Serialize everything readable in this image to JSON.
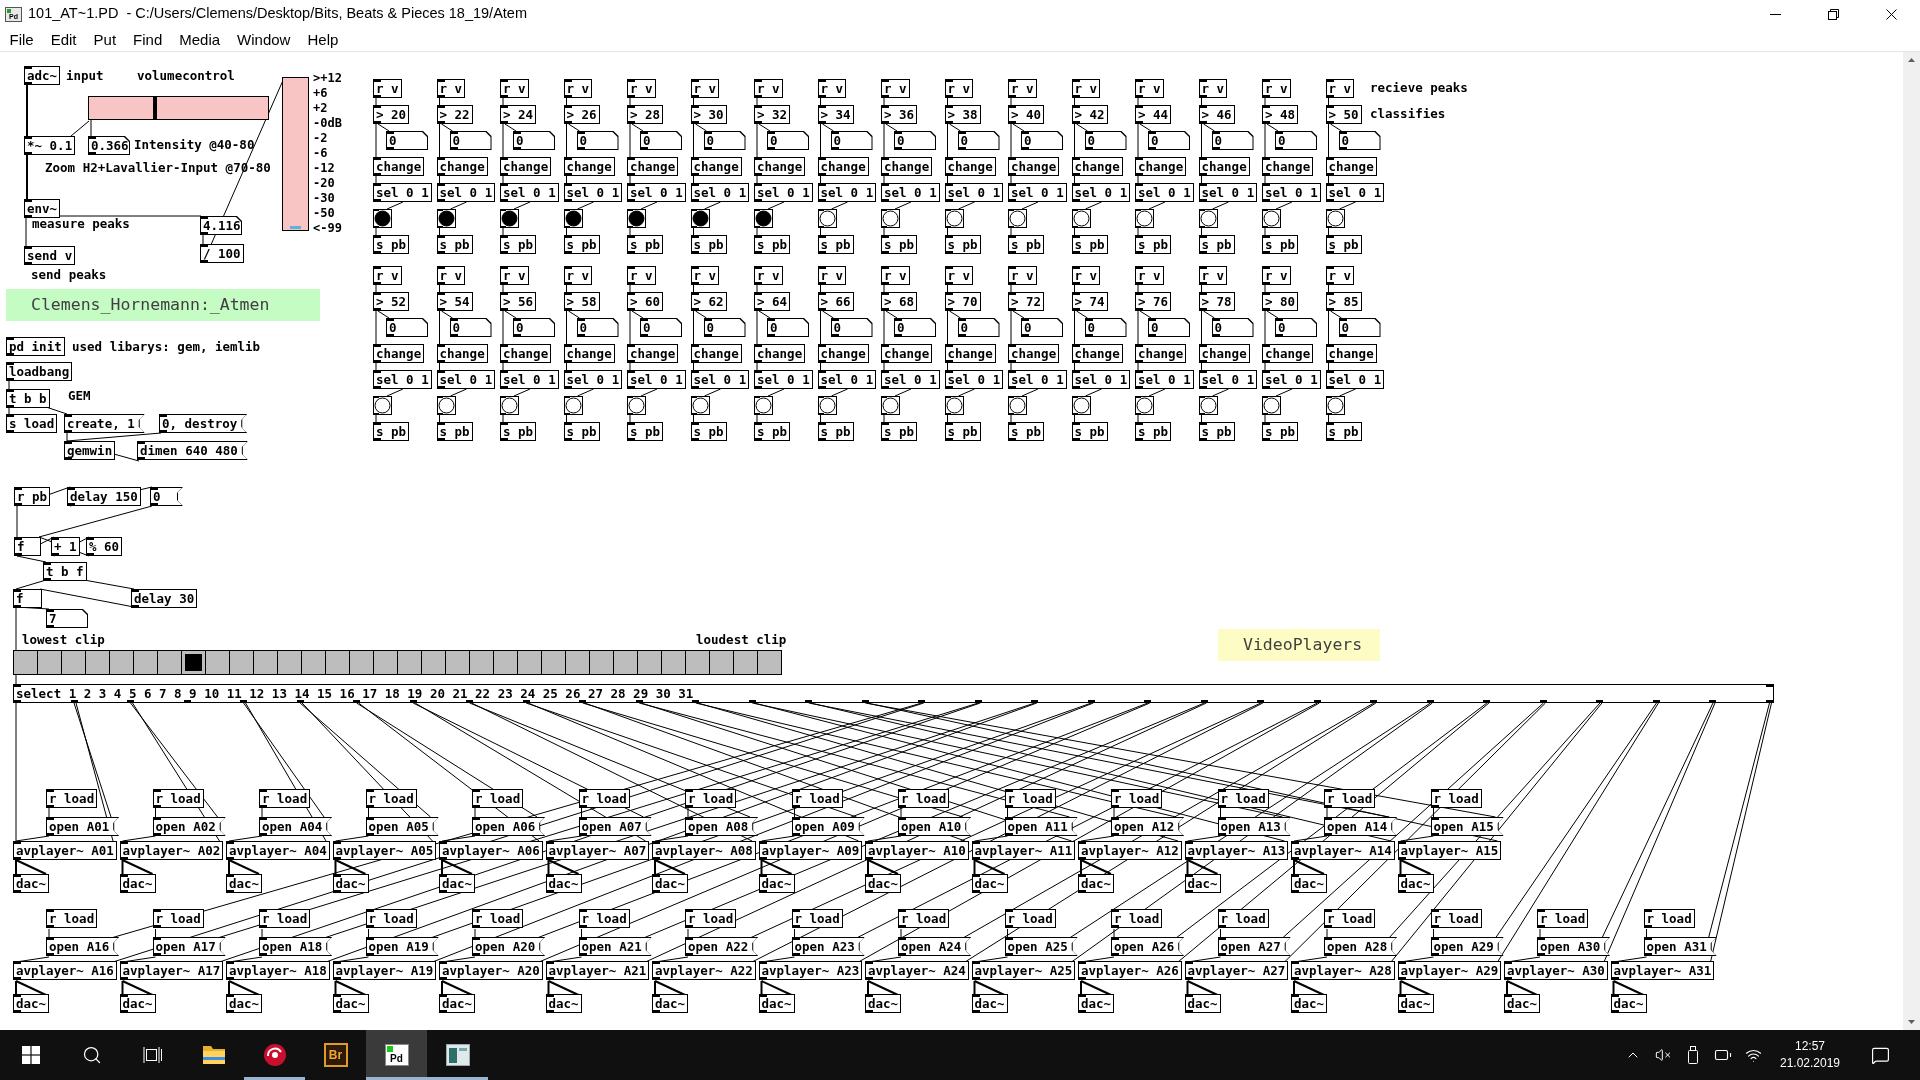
{
  "window": {
    "icon_text": "Pd",
    "title": "101_AT~1.PD  - C:/Users/Clemens/Desktop/Bits, Beats & Pieces 18_19/Atem"
  },
  "menu": [
    "File",
    "Edit",
    "Put",
    "Find",
    "Media",
    "Window",
    "Help"
  ],
  "patch": {
    "objects": [
      {
        "kind": "object",
        "text": "adc~"
      },
      {
        "kind": "comment",
        "text": "input"
      },
      {
        "kind": "comment",
        "text": "volumecontrol"
      },
      {
        "kind": "object",
        "text": "*~ 0.1"
      },
      {
        "kind": "number",
        "text": "0.366"
      },
      {
        "kind": "comment",
        "text": "Intensity @40-80"
      },
      {
        "kind": "comment",
        "text": "Zoom H2+Lavallier-Input @70-80"
      },
      {
        "kind": "object",
        "text": "env~"
      },
      {
        "kind": "comment",
        "text": "measure peaks"
      },
      {
        "kind": "number",
        "text": "4.116"
      },
      {
        "kind": "object",
        "text": "/ 100"
      },
      {
        "kind": "object",
        "text": "send v"
      },
      {
        "kind": "comment",
        "text": "send peaks"
      },
      {
        "kind": "canvas_label",
        "text": "Clemens_Hornemann:_Atmen",
        "color": "#c4fcc4"
      },
      {
        "kind": "object",
        "text": "pd init"
      },
      {
        "kind": "comment",
        "text": "used libarys: gem, iemlib"
      },
      {
        "kind": "object",
        "text": "loadbang"
      },
      {
        "kind": "object",
        "text": "t b b"
      },
      {
        "kind": "comment",
        "text": "GEM"
      },
      {
        "kind": "object",
        "text": "s load"
      },
      {
        "kind": "message",
        "text": "create, 1"
      },
      {
        "kind": "message",
        "text": "0, destroy"
      },
      {
        "kind": "object",
        "text": "gemwin"
      },
      {
        "kind": "message",
        "text": "dimen 640 480"
      },
      {
        "kind": "object",
        "text": "r pb"
      },
      {
        "kind": "object",
        "text": "delay 150"
      },
      {
        "kind": "message",
        "text": "0"
      },
      {
        "kind": "object",
        "text": "f"
      },
      {
        "kind": "object",
        "text": "+ 1"
      },
      {
        "kind": "object",
        "text": "% 60"
      },
      {
        "kind": "object",
        "text": "t b f"
      },
      {
        "kind": "object",
        "text": "f"
      },
      {
        "kind": "object",
        "text": "delay 30"
      },
      {
        "kind": "number",
        "text": "7"
      },
      {
        "kind": "comment",
        "text": "lowest clip"
      },
      {
        "kind": "comment",
        "text": "loudest clip"
      },
      {
        "kind": "canvas_label",
        "text": "VideoPlayers",
        "color": "#fcfcc4"
      }
    ],
    "volume_slider": {
      "level": 0.366
    },
    "vu_meter": {
      "level": 0.02,
      "scale": [
        ">+12",
        "+6",
        "+2",
        "-0dB",
        "-2",
        "-6",
        "-12",
        "-20",
        "-30",
        "-50",
        "<-99"
      ]
    },
    "peak_comments": [
      "recieve peaks",
      "classifies"
    ],
    "peak_blocks": [
      {
        "columns": [
          {
            "receive": "r v",
            "compare": "> 20",
            "number": "0",
            "change": "change",
            "select": "sel 0 1",
            "bang": {
              "on": true
            },
            "send": "s pb"
          },
          {
            "receive": "r v",
            "compare": "> 22",
            "number": "0",
            "change": "change",
            "select": "sel 0 1",
            "bang": {
              "on": true
            },
            "send": "s pb"
          },
          {
            "receive": "r v",
            "compare": "> 24",
            "number": "0",
            "change": "change",
            "select": "sel 0 1",
            "bang": {
              "on": true
            },
            "send": "s pb"
          },
          {
            "receive": "r v",
            "compare": "> 26",
            "number": "0",
            "change": "change",
            "select": "sel 0 1",
            "bang": {
              "on": true
            },
            "send": "s pb"
          },
          {
            "receive": "r v",
            "compare": "> 28",
            "number": "0",
            "change": "change",
            "select": "sel 0 1",
            "bang": {
              "on": true
            },
            "send": "s pb"
          },
          {
            "receive": "r v",
            "compare": "> 30",
            "number": "0",
            "change": "change",
            "select": "sel 0 1",
            "bang": {
              "on": true
            },
            "send": "s pb"
          },
          {
            "receive": "r v",
            "compare": "> 32",
            "number": "0",
            "change": "change",
            "select": "sel 0 1",
            "bang": {
              "on": true
            },
            "send": "s pb"
          },
          {
            "receive": "r v",
            "compare": "> 34",
            "number": "0",
            "change": "change",
            "select": "sel 0 1",
            "bang": {
              "on": false
            },
            "send": "s pb"
          },
          {
            "receive": "r v",
            "compare": "> 36",
            "number": "0",
            "change": "change",
            "select": "sel 0 1",
            "bang": {
              "on": false
            },
            "send": "s pb"
          },
          {
            "receive": "r v",
            "compare": "> 38",
            "number": "0",
            "change": "change",
            "select": "sel 0 1",
            "bang": {
              "on": false
            },
            "send": "s pb"
          },
          {
            "receive": "r v",
            "compare": "> 40",
            "number": "0",
            "change": "change",
            "select": "sel 0 1",
            "bang": {
              "on": false
            },
            "send": "s pb"
          },
          {
            "receive": "r v",
            "compare": "> 42",
            "number": "0",
            "change": "change",
            "select": "sel 0 1",
            "bang": {
              "on": false
            },
            "send": "s pb"
          },
          {
            "receive": "r v",
            "compare": "> 44",
            "number": "0",
            "change": "change",
            "select": "sel 0 1",
            "bang": {
              "on": false
            },
            "send": "s pb"
          },
          {
            "receive": "r v",
            "compare": "> 46",
            "number": "0",
            "change": "change",
            "select": "sel 0 1",
            "bang": {
              "on": false
            },
            "send": "s pb"
          },
          {
            "receive": "r v",
            "compare": "> 48",
            "number": "0",
            "change": "change",
            "select": "sel 0 1",
            "bang": {
              "on": false
            },
            "send": "s pb"
          },
          {
            "receive": "r v",
            "compare": "> 50",
            "number": "0",
            "change": "change",
            "select": "sel 0 1",
            "bang": {
              "on": false
            },
            "send": "s pb"
          }
        ]
      },
      {
        "columns": [
          {
            "receive": "r v",
            "compare": "> 52",
            "number": "0",
            "change": "change",
            "select": "sel 0 1",
            "bang": {
              "on": false
            },
            "send": "s pb"
          },
          {
            "receive": "r v",
            "compare": "> 54",
            "number": "0",
            "change": "change",
            "select": "sel 0 1",
            "bang": {
              "on": false
            },
            "send": "s pb"
          },
          {
            "receive": "r v",
            "compare": "> 56",
            "number": "0",
            "change": "change",
            "select": "sel 0 1",
            "bang": {
              "on": false
            },
            "send": "s pb"
          },
          {
            "receive": "r v",
            "compare": "> 58",
            "number": "0",
            "change": "change",
            "select": "sel 0 1",
            "bang": {
              "on": false
            },
            "send": "s pb"
          },
          {
            "receive": "r v",
            "compare": "> 60",
            "number": "0",
            "change": "change",
            "select": "sel 0 1",
            "bang": {
              "on": false
            },
            "send": "s pb"
          },
          {
            "receive": "r v",
            "compare": "> 62",
            "number": "0",
            "change": "change",
            "select": "sel 0 1",
            "bang": {
              "on": false
            },
            "send": "s pb"
          },
          {
            "receive": "r v",
            "compare": "> 64",
            "number": "0",
            "change": "change",
            "select": "sel 0 1",
            "bang": {
              "on": false
            },
            "send": "s pb"
          },
          {
            "receive": "r v",
            "compare": "> 66",
            "number": "0",
            "change": "change",
            "select": "sel 0 1",
            "bang": {
              "on": false
            },
            "send": "s pb"
          },
          {
            "receive": "r v",
            "compare": "> 68",
            "number": "0",
            "change": "change",
            "select": "sel 0 1",
            "bang": {
              "on": false
            },
            "send": "s pb"
          },
          {
            "receive": "r v",
            "compare": "> 70",
            "number": "0",
            "change": "change",
            "select": "sel 0 1",
            "bang": {
              "on": false
            },
            "send": "s pb"
          },
          {
            "receive": "r v",
            "compare": "> 72",
            "number": "0",
            "change": "change",
            "select": "sel 0 1",
            "bang": {
              "on": false
            },
            "send": "s pb"
          },
          {
            "receive": "r v",
            "compare": "> 74",
            "number": "0",
            "change": "change",
            "select": "sel 0 1",
            "bang": {
              "on": false
            },
            "send": "s pb"
          },
          {
            "receive": "r v",
            "compare": "> 76",
            "number": "0",
            "change": "change",
            "select": "sel 0 1",
            "bang": {
              "on": false
            },
            "send": "s pb"
          },
          {
            "receive": "r v",
            "compare": "> 78",
            "number": "0",
            "change": "change",
            "select": "sel 0 1",
            "bang": {
              "on": false
            },
            "send": "s pb"
          },
          {
            "receive": "r v",
            "compare": "> 80",
            "number": "0",
            "change": "change",
            "select": "sel 0 1",
            "bang": {
              "on": false
            },
            "send": "s pb"
          },
          {
            "receive": "r v",
            "compare": "> 85",
            "number": "0",
            "change": "change",
            "select": "sel 0 1",
            "bang": {
              "on": false
            },
            "send": "s pb"
          }
        ]
      }
    ],
    "clip_selector": {
      "cells": [
        {
          "selected": false
        },
        {
          "selected": false
        },
        {
          "selected": false
        },
        {
          "selected": false
        },
        {
          "selected": false
        },
        {
          "selected": false
        },
        {
          "selected": false
        },
        {
          "selected": true
        },
        {
          "selected": false
        },
        {
          "selected": false
        },
        {
          "selected": false
        },
        {
          "selected": false
        },
        {
          "selected": false
        },
        {
          "selected": false
        },
        {
          "selected": false
        },
        {
          "selected": false
        },
        {
          "selected": false
        },
        {
          "selected": false
        },
        {
          "selected": false
        },
        {
          "selected": false
        },
        {
          "selected": false
        },
        {
          "selected": false
        },
        {
          "selected": false
        },
        {
          "selected": false
        },
        {
          "selected": false
        },
        {
          "selected": false
        },
        {
          "selected": false
        },
        {
          "selected": false
        },
        {
          "selected": false
        },
        {
          "selected": false
        },
        {
          "selected": false
        },
        {
          "selected": false
        }
      ]
    },
    "select_object": "select 1 2 3 4 5 6 7 8 9 10 11 12 13 14 15 16 17 18 19 20 21 22 23 24 25 26 27 28 29 30 31",
    "player_rows": [
      {
        "players": [
          {
            "receive": "r load",
            "message": "open A01",
            "player": "avplayer~ A01",
            "output": "dac~"
          },
          {
            "receive": "r load",
            "message": "open A02",
            "player": "avplayer~ A02",
            "output": "dac~"
          },
          {
            "receive": "r load",
            "message": "open A04",
            "player": "avplayer~ A04",
            "output": "dac~"
          },
          {
            "receive": "r load",
            "message": "open A05",
            "player": "avplayer~ A05",
            "output": "dac~"
          },
          {
            "receive": "r load",
            "message": "open A06",
            "player": "avplayer~ A06",
            "output": "dac~"
          },
          {
            "receive": "r load",
            "message": "open A07",
            "player": "avplayer~ A07",
            "output": "dac~"
          },
          {
            "receive": "r load",
            "message": "open A08",
            "player": "avplayer~ A08",
            "output": "dac~"
          },
          {
            "receive": "r load",
            "message": "open A09",
            "player": "avplayer~ A09",
            "output": "dac~"
          },
          {
            "receive": "r load",
            "message": "open A10",
            "player": "avplayer~ A10",
            "output": "dac~"
          },
          {
            "receive": "r load",
            "message": "open A11",
            "player": "avplayer~ A11",
            "output": "dac~"
          },
          {
            "receive": "r load",
            "message": "open A12",
            "player": "avplayer~ A12",
            "output": "dac~"
          },
          {
            "receive": "r load",
            "message": "open A13",
            "player": "avplayer~ A13",
            "output": "dac~"
          },
          {
            "receive": "r load",
            "message": "open A14",
            "player": "avplayer~ A14",
            "output": "dac~"
          },
          {
            "receive": "r load",
            "message": "open A15",
            "player": "avplayer~ A15",
            "output": "dac~"
          }
        ]
      },
      {
        "players": [
          {
            "receive": "r load",
            "message": "open A16",
            "player": "avplayer~ A16",
            "output": "dac~"
          },
          {
            "receive": "r load",
            "message": "open A17",
            "player": "avplayer~ A17",
            "output": "dac~"
          },
          {
            "receive": "r load",
            "message": "open A18",
            "player": "avplayer~ A18",
            "output": "dac~"
          },
          {
            "receive": "r load",
            "message": "open A19",
            "player": "avplayer~ A19",
            "output": "dac~"
          },
          {
            "receive": "r load",
            "message": "open A20",
            "player": "avplayer~ A20",
            "output": "dac~"
          },
          {
            "receive": "r load",
            "message": "open A21",
            "player": "avplayer~ A21",
            "output": "dac~"
          },
          {
            "receive": "r load",
            "message": "open A22",
            "player": "avplayer~ A22",
            "output": "dac~"
          },
          {
            "receive": "r load",
            "message": "open A23",
            "player": "avplayer~ A23",
            "output": "dac~"
          },
          {
            "receive": "r load",
            "message": "open A24",
            "player": "avplayer~ A24",
            "output": "dac~"
          },
          {
            "receive": "r load",
            "message": "open A25",
            "player": "avplayer~ A25",
            "output": "dac~"
          },
          {
            "receive": "r load",
            "message": "open A26",
            "player": "avplayer~ A26",
            "output": "dac~"
          },
          {
            "receive": "r load",
            "message": "open A27",
            "player": "avplayer~ A27",
            "output": "dac~"
          },
          {
            "receive": "r load",
            "message": "open A28",
            "player": "avplayer~ A28",
            "output": "dac~"
          },
          {
            "receive": "r load",
            "message": "open A29",
            "player": "avplayer~ A29",
            "output": "dac~"
          },
          {
            "receive": "r load",
            "message": "open A30",
            "player": "avplayer~ A30",
            "output": "dac~"
          },
          {
            "receive": "r load",
            "message": "open A31",
            "player": "avplayer~ A31",
            "output": "dac~"
          }
        ]
      }
    ]
  },
  "taskbar": {
    "apps": [
      {
        "kind": "folder",
        "running": false,
        "selected": false
      },
      {
        "kind": "disc",
        "running": true,
        "selected": false
      },
      {
        "kind": "lettertile",
        "label": "Br",
        "running": false,
        "selected": false
      },
      {
        "kind": "pdtile",
        "label": "Pd",
        "running": true,
        "selected": true
      },
      {
        "kind": "window",
        "running": true,
        "selected": false
      }
    ],
    "time": "12:57",
    "date": "21.02.2019"
  }
}
